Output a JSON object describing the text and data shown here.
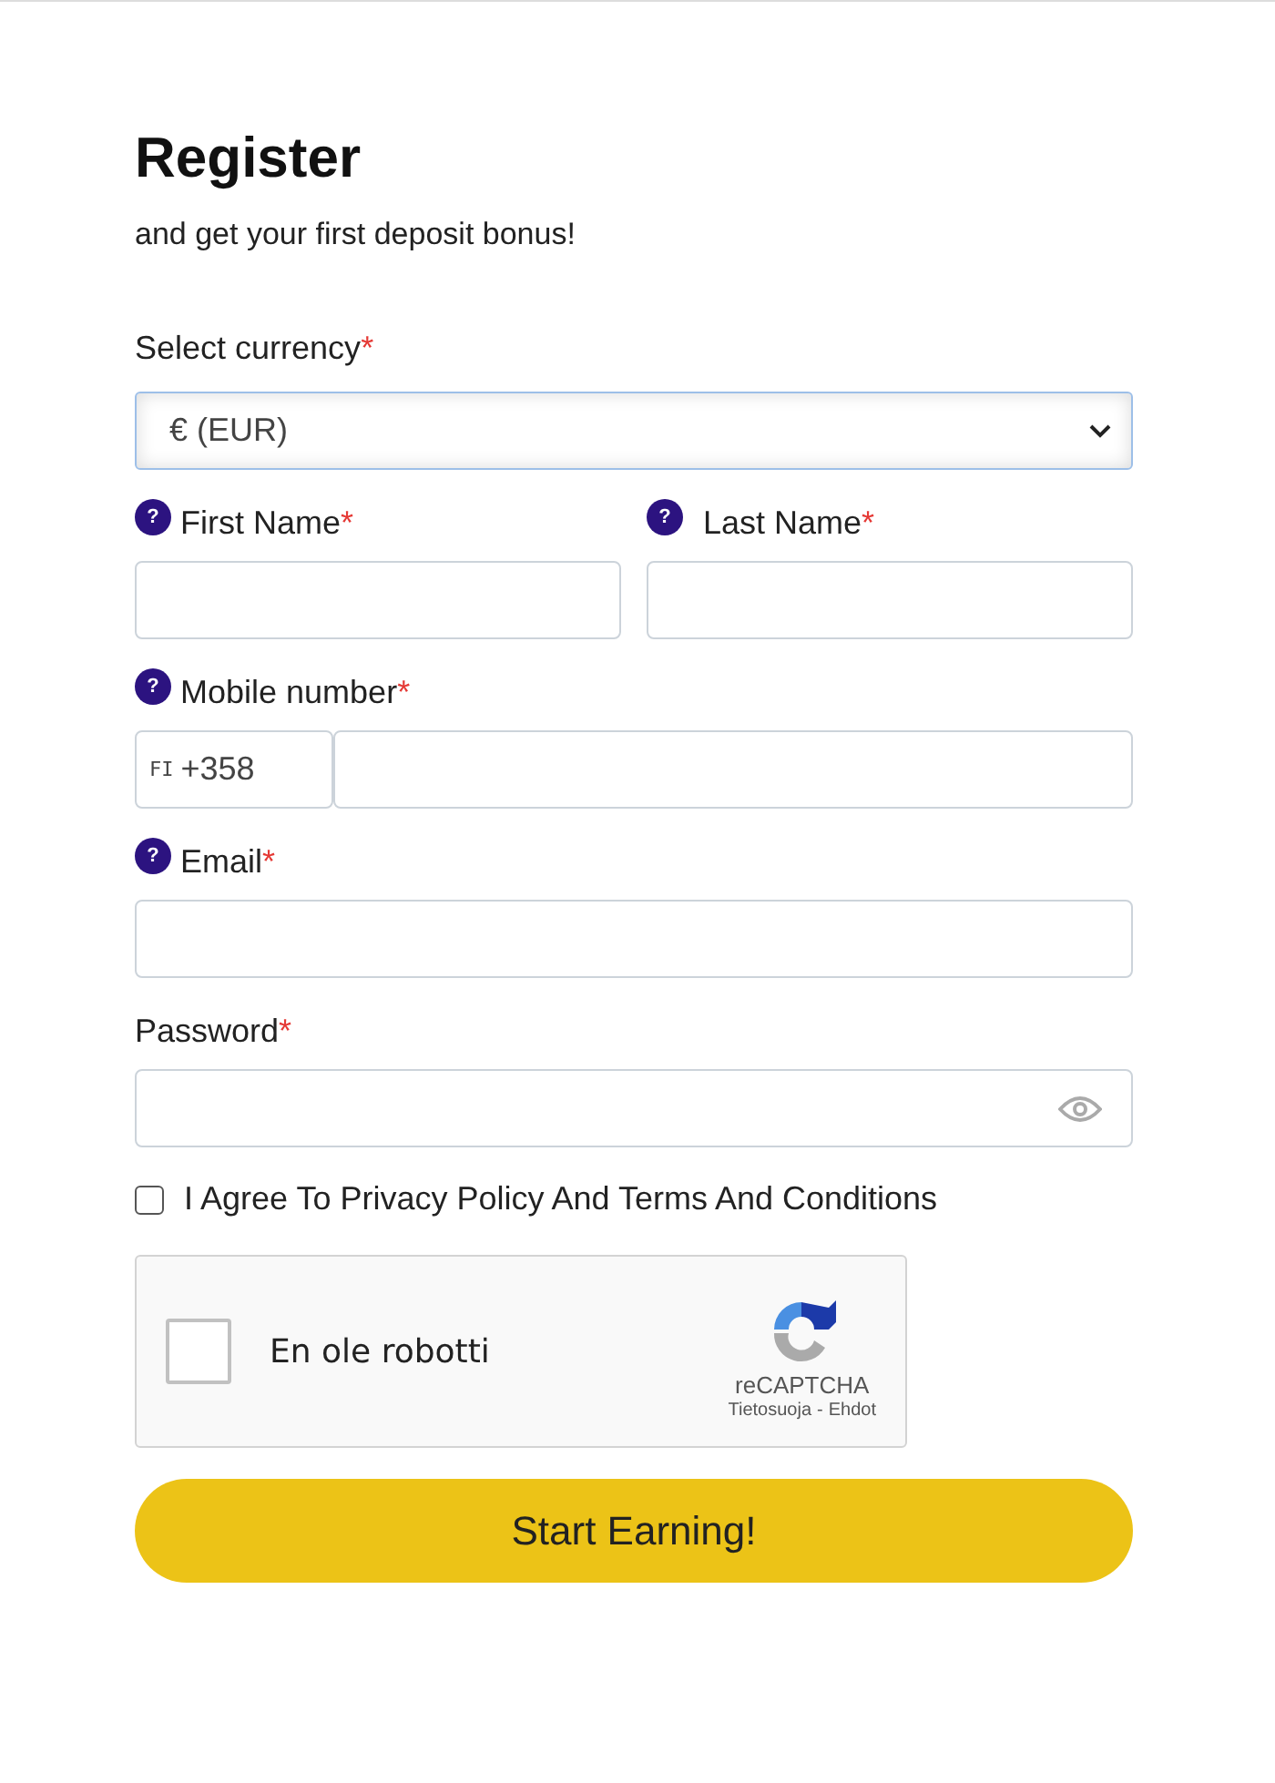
{
  "title": "Register",
  "subtitle": "and get your first deposit bonus!",
  "currency": {
    "label": "Select currency",
    "required_mark": "*",
    "value": "€ (EUR)"
  },
  "name_fields": [
    {
      "label": "First Name",
      "required_mark": "*",
      "help": "?"
    },
    {
      "label": "Last Name",
      "required_mark": "*",
      "help": "?"
    }
  ],
  "mobile": {
    "label": "Mobile number",
    "required_mark": "*",
    "help": "?",
    "country_code": "FI",
    "prefix": "+358"
  },
  "email": {
    "label": "Email",
    "required_mark": "*",
    "help": "?"
  },
  "password": {
    "label": "Password",
    "required_mark": "*"
  },
  "agree": {
    "label": "I Agree To Privacy Policy And Terms And Conditions",
    "checked": false
  },
  "captcha": {
    "label": "En ole robotti",
    "checked": false,
    "brand": "reCAPTCHA",
    "privacy": "Tietosuoja",
    "separator": "-",
    "terms": "Ehdot"
  },
  "submit": "Start Earning!"
}
